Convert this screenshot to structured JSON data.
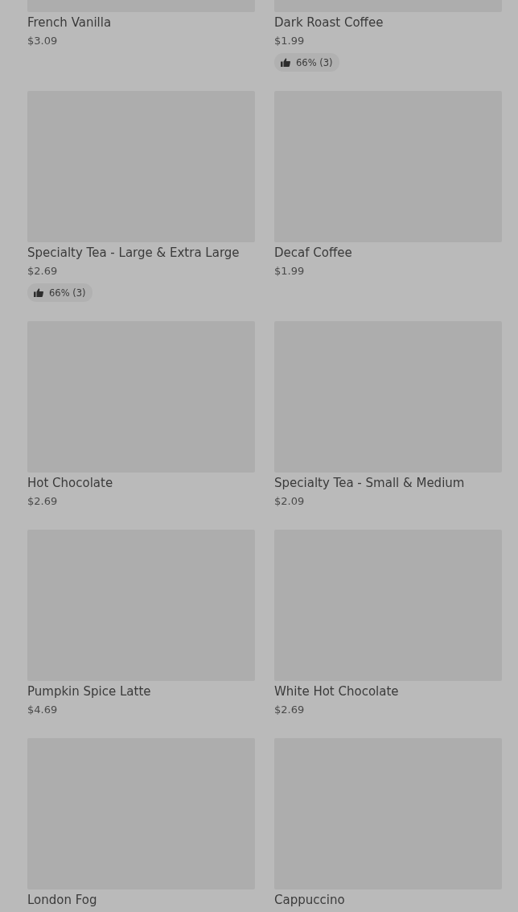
{
  "products": [
    {
      "name": "French Vanilla",
      "price": "$3.09"
    },
    {
      "name": "Dark Roast Coffee",
      "price": "$1.99",
      "rating": "66% (3)"
    },
    {
      "name": "Specialty Tea - Large & Extra Large",
      "price": "$2.69",
      "rating": "66% (3)"
    },
    {
      "name": "Decaf Coffee",
      "price": "$1.99"
    },
    {
      "name": "Hot Chocolate",
      "price": "$2.69"
    },
    {
      "name": "Specialty Tea - Small & Medium",
      "price": "$2.09"
    },
    {
      "name": "Pumpkin Spice Latte",
      "price": "$4.69"
    },
    {
      "name": "White Hot Chocolate",
      "price": "$2.69"
    },
    {
      "name": "London Fog"
    },
    {
      "name": "Cappuccino"
    }
  ]
}
